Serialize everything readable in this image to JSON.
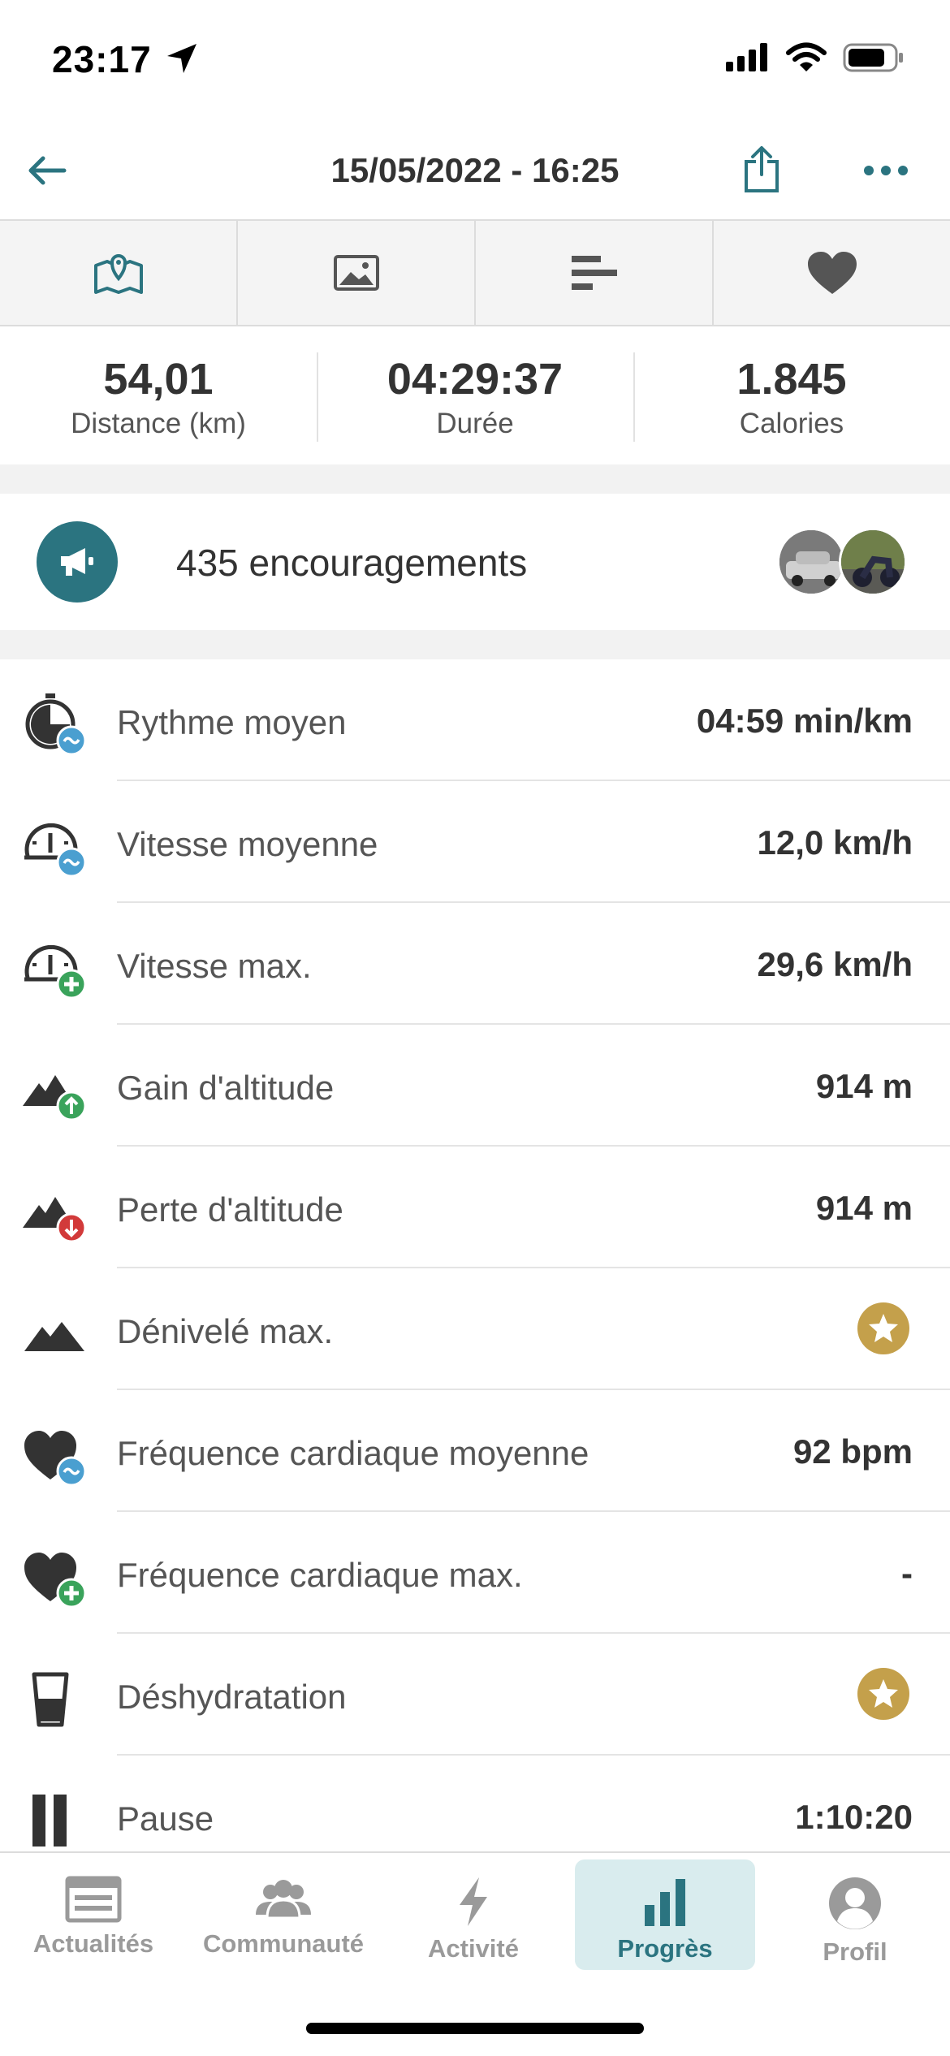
{
  "status_bar": {
    "time": "23:17"
  },
  "header": {
    "title": "15/05/2022 - 16:25"
  },
  "tabs": [
    {
      "name": "map"
    },
    {
      "name": "photos"
    },
    {
      "name": "stats"
    },
    {
      "name": "heart"
    }
  ],
  "summary": [
    {
      "value": "54,01",
      "label": "Distance (km)"
    },
    {
      "value": "04:29:37",
      "label": "Durée"
    },
    {
      "value": "1.845",
      "label": "Calories"
    }
  ],
  "cheers": {
    "text": "435 encouragements"
  },
  "stats": [
    {
      "label": "Rythme moyen",
      "value": "04:59 min/km",
      "icon": "stopwatch-avg-icon"
    },
    {
      "label": "Vitesse moyenne",
      "value": "12,0 km/h",
      "icon": "speedometer-avg-icon"
    },
    {
      "label": "Vitesse max.",
      "value": "29,6 km/h",
      "icon": "speedometer-max-icon"
    },
    {
      "label": "Gain d'altitude",
      "value": "914 m",
      "icon": "mountain-up-icon"
    },
    {
      "label": "Perte d'altitude",
      "value": "914 m",
      "icon": "mountain-down-icon"
    },
    {
      "label": "Dénivelé max.",
      "value": "",
      "icon": "mountain-icon",
      "premium": true
    },
    {
      "label": "Fréquence cardiaque moyenne",
      "value": "92 bpm",
      "icon": "heart-avg-icon"
    },
    {
      "label": "Fréquence cardiaque max.",
      "value": "-",
      "icon": "heart-max-icon"
    },
    {
      "label": "Déshydratation",
      "value": "",
      "icon": "glass-icon",
      "premium": true
    },
    {
      "label": "Pause",
      "value": "1:10:20",
      "icon": "pause-icon"
    }
  ],
  "bottom_nav": [
    {
      "label": "Actualités",
      "active": false
    },
    {
      "label": "Communauté",
      "active": false
    },
    {
      "label": "Activité",
      "active": false
    },
    {
      "label": "Progrès",
      "active": true
    },
    {
      "label": "Profil",
      "active": false
    }
  ],
  "colors": {
    "accent": "#2b7480",
    "premium_gold": "#c4a04b",
    "badge_blue": "#4a9fd0",
    "badge_green": "#3aa35b",
    "badge_red": "#d23a3a"
  }
}
